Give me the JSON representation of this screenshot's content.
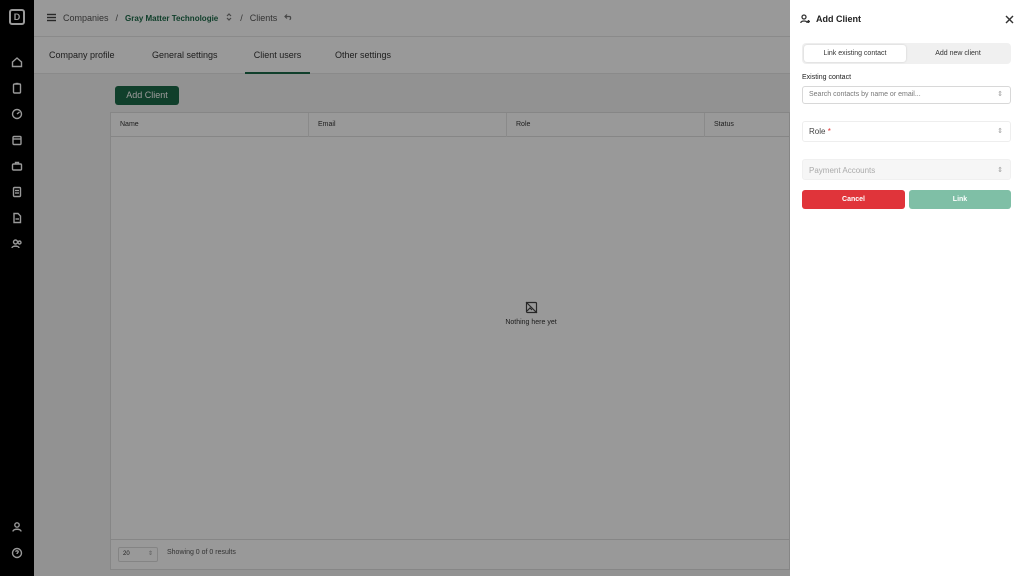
{
  "app": {
    "logo_letter": "D"
  },
  "rail": {
    "icons": [
      "home-icon",
      "clipboard-icon",
      "gauge-icon",
      "calendar-icon",
      "briefcase-icon",
      "document-icon",
      "file-icon",
      "users-icon",
      "user-icon",
      "help-icon"
    ]
  },
  "breadcrumb": {
    "companies": "Companies",
    "separator": "/",
    "company": "Gray Matter Technologie",
    "clients": "Clients"
  },
  "tabs": [
    {
      "label": "Company profile"
    },
    {
      "label": "General settings"
    },
    {
      "label": "Client users"
    },
    {
      "label": "Other settings"
    }
  ],
  "active_tab": "Client users",
  "main": {
    "add_button": "Add Client",
    "columns": [
      "Name",
      "Email",
      "Role",
      "Status"
    ],
    "empty_message": "Nothing here yet",
    "page_size": "20",
    "results_text": "Showing 0 of 0 results"
  },
  "drawer": {
    "title": "Add Client",
    "segments": [
      "Link existing contact",
      "Add new client"
    ],
    "selected_segment": "Link existing contact",
    "existing_contact_label": "Existing contact",
    "search_placeholder": "Search contacts by name or email...",
    "role_label": "Role",
    "required_mark": "*",
    "payment_accounts_placeholder": "Payment Accounts",
    "cancel_label": "Cancel",
    "link_label": "Link"
  },
  "colors": {
    "brand_green": "#1c6a48",
    "cancel_red": "#e0343a",
    "link_disabled": "#7fbfa6",
    "rail_bg": "#000000"
  }
}
